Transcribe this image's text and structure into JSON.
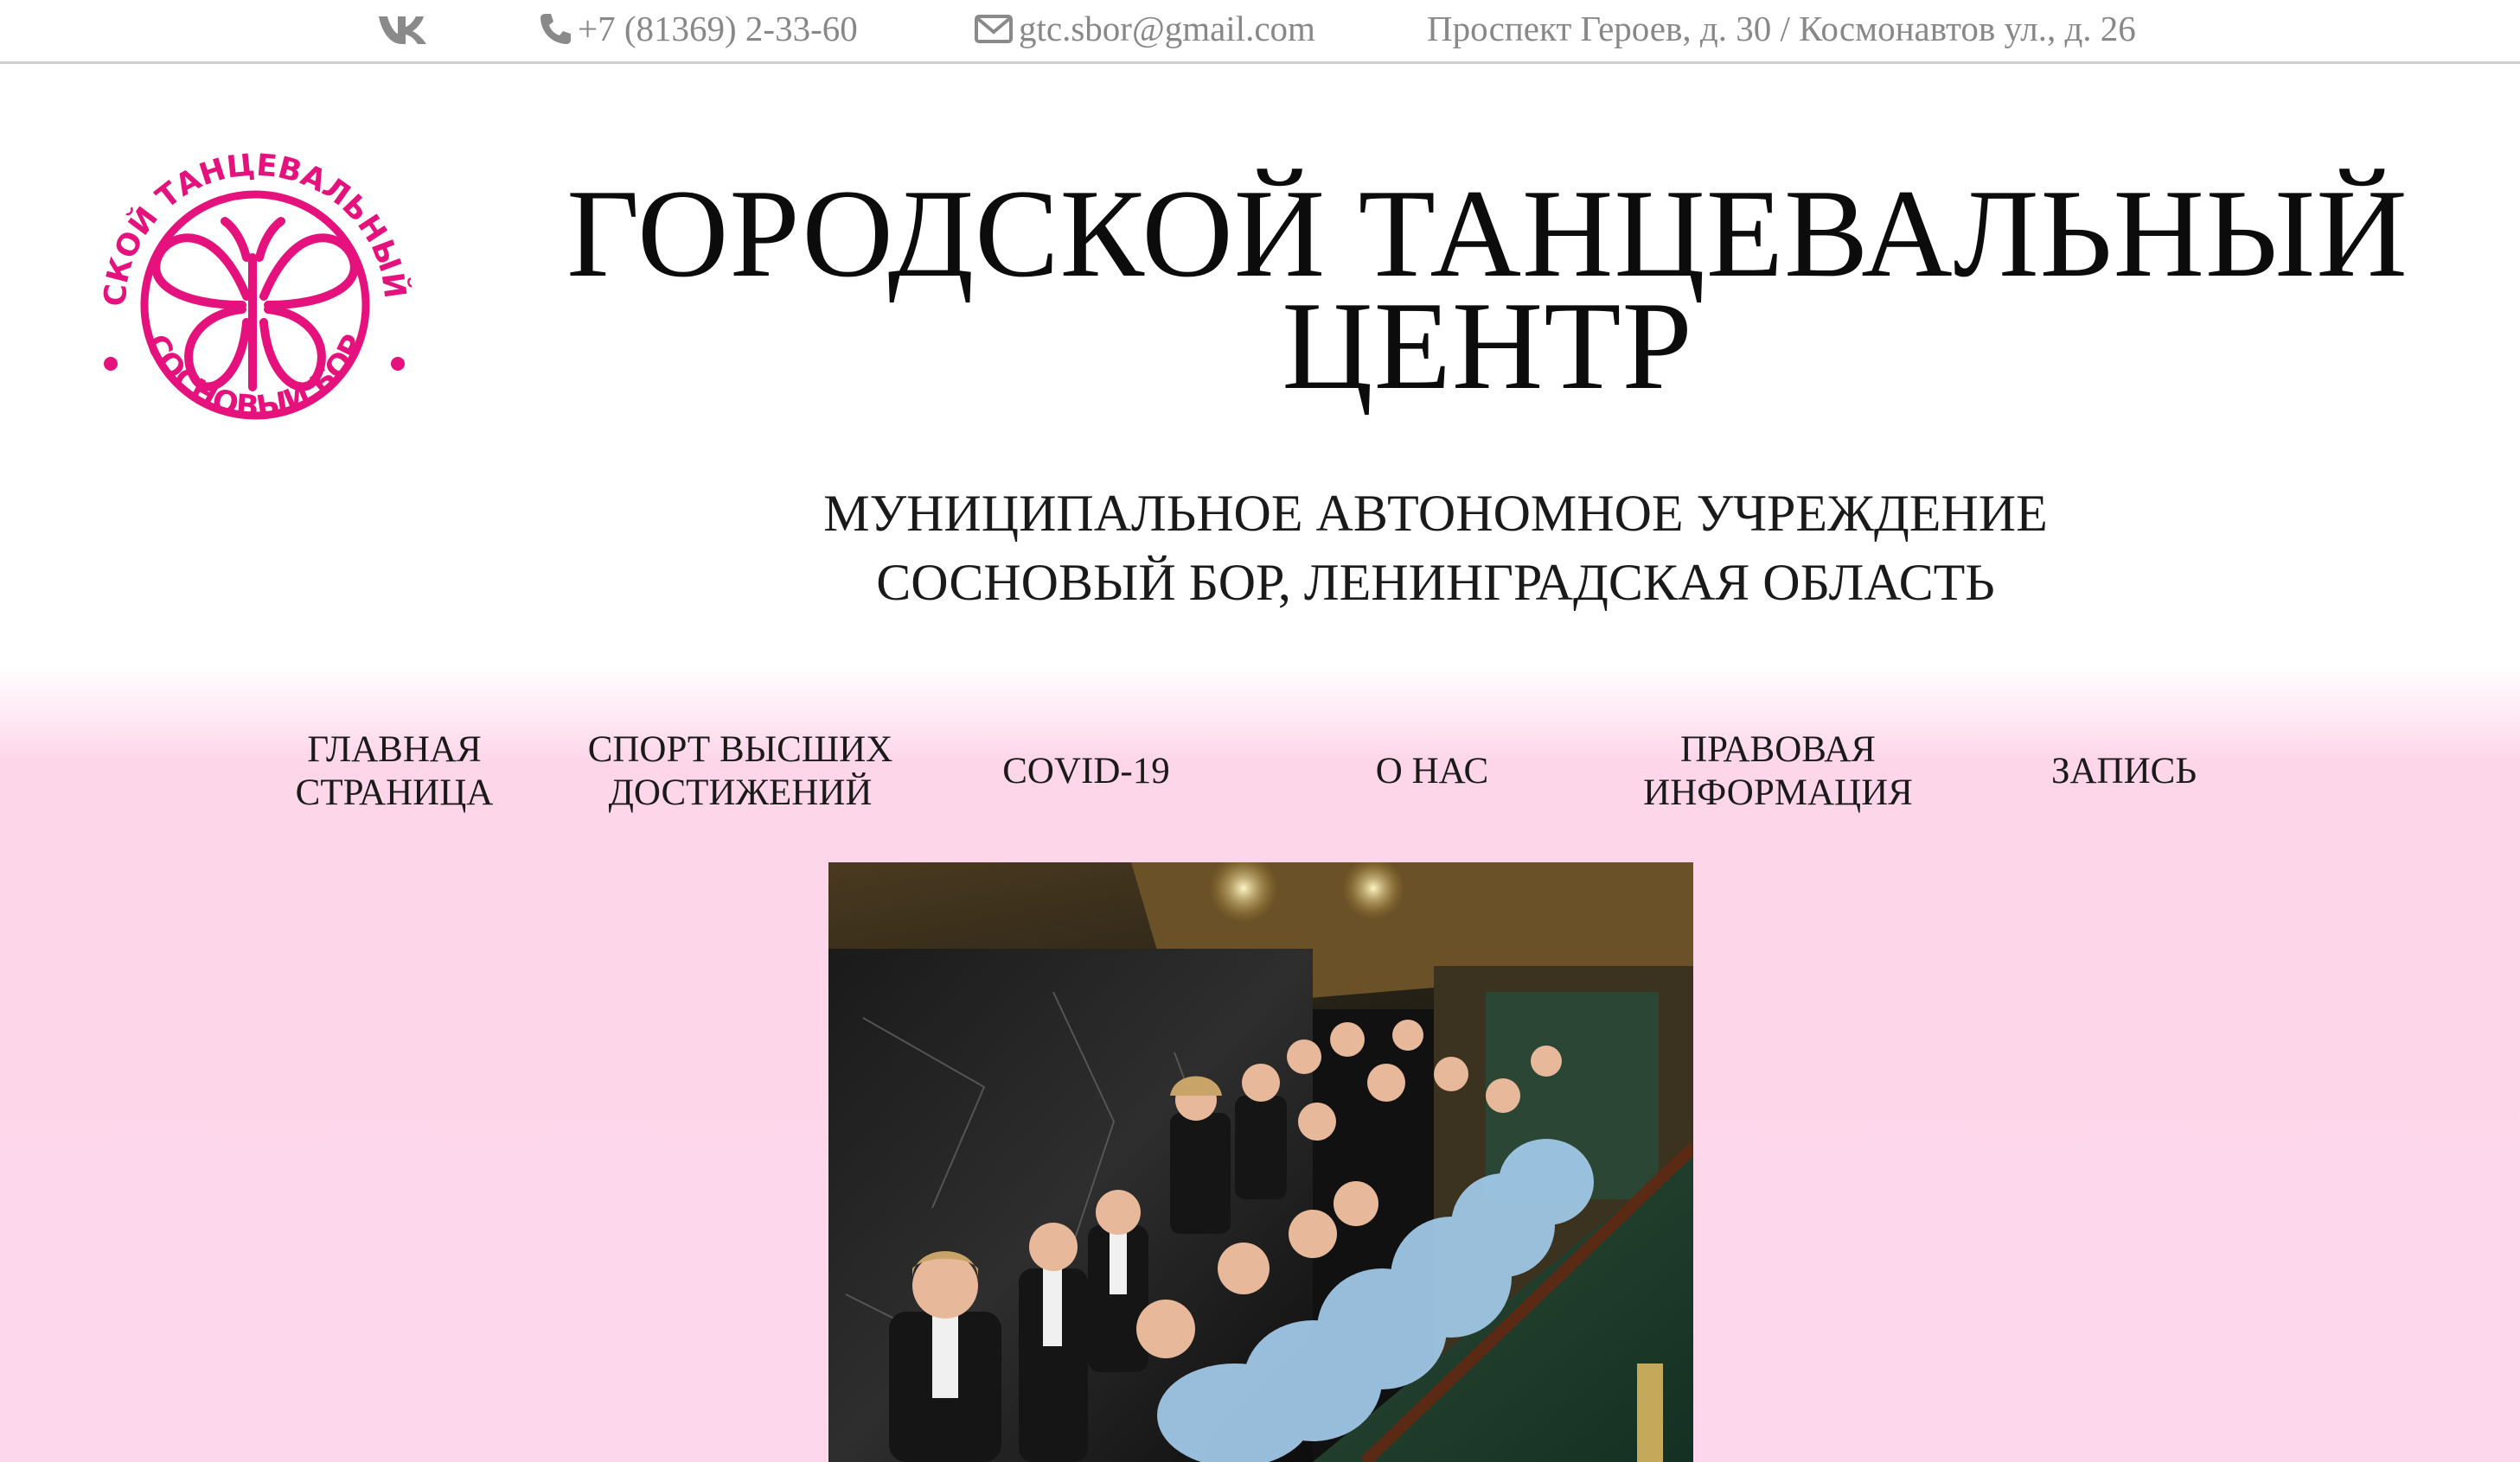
{
  "topbar": {
    "vk_icon": "vk-icon",
    "phone": "+7 (81369) 2-33-60",
    "email": "gtc.sbor@gmail.com",
    "address": "Проспект Героев, д. 30 / Космонавтов ул., д. 26"
  },
  "logo": {
    "text_top": "ГОРОДСКОЙ ТАНЦЕВАЛЬНЫЙ ЦЕНТР",
    "text_bottom": "СОСНОВЫЙ БОР",
    "color": "#e5127d"
  },
  "header": {
    "title_line1": "ГОРОДСКОЙ ТАНЦЕВАЛЬНЫЙ",
    "title_line2": "ЦЕНТР",
    "subtitle_line1": "МУНИЦИПАЛЬНОЕ АВТОНОМНОЕ УЧРЕЖДЕНИЕ",
    "subtitle_line2": "СОСНОВЫЙ БОР, ЛЕНИНГРАДСКАЯ ОБЛАСТЬ"
  },
  "nav": {
    "items": [
      {
        "line1": "ГЛАВНАЯ",
        "line2": "СТРАНИЦА"
      },
      {
        "line1": "СПОРТ ВЫСШИХ",
        "line2": "ДОСТИЖЕНИЙ"
      },
      {
        "line1": "COVID-19",
        "line2": ""
      },
      {
        "line1": "О НАС",
        "line2": ""
      },
      {
        "line1": "ПРАВОВАЯ",
        "line2": "ИНФОРМАЦИЯ"
      },
      {
        "line1": "ЗАПИСЬ",
        "line2": ""
      }
    ]
  },
  "colors": {
    "brand_pink": "#e5127d",
    "background_pink": "#fdd6ea",
    "topbar_text": "#888888"
  }
}
